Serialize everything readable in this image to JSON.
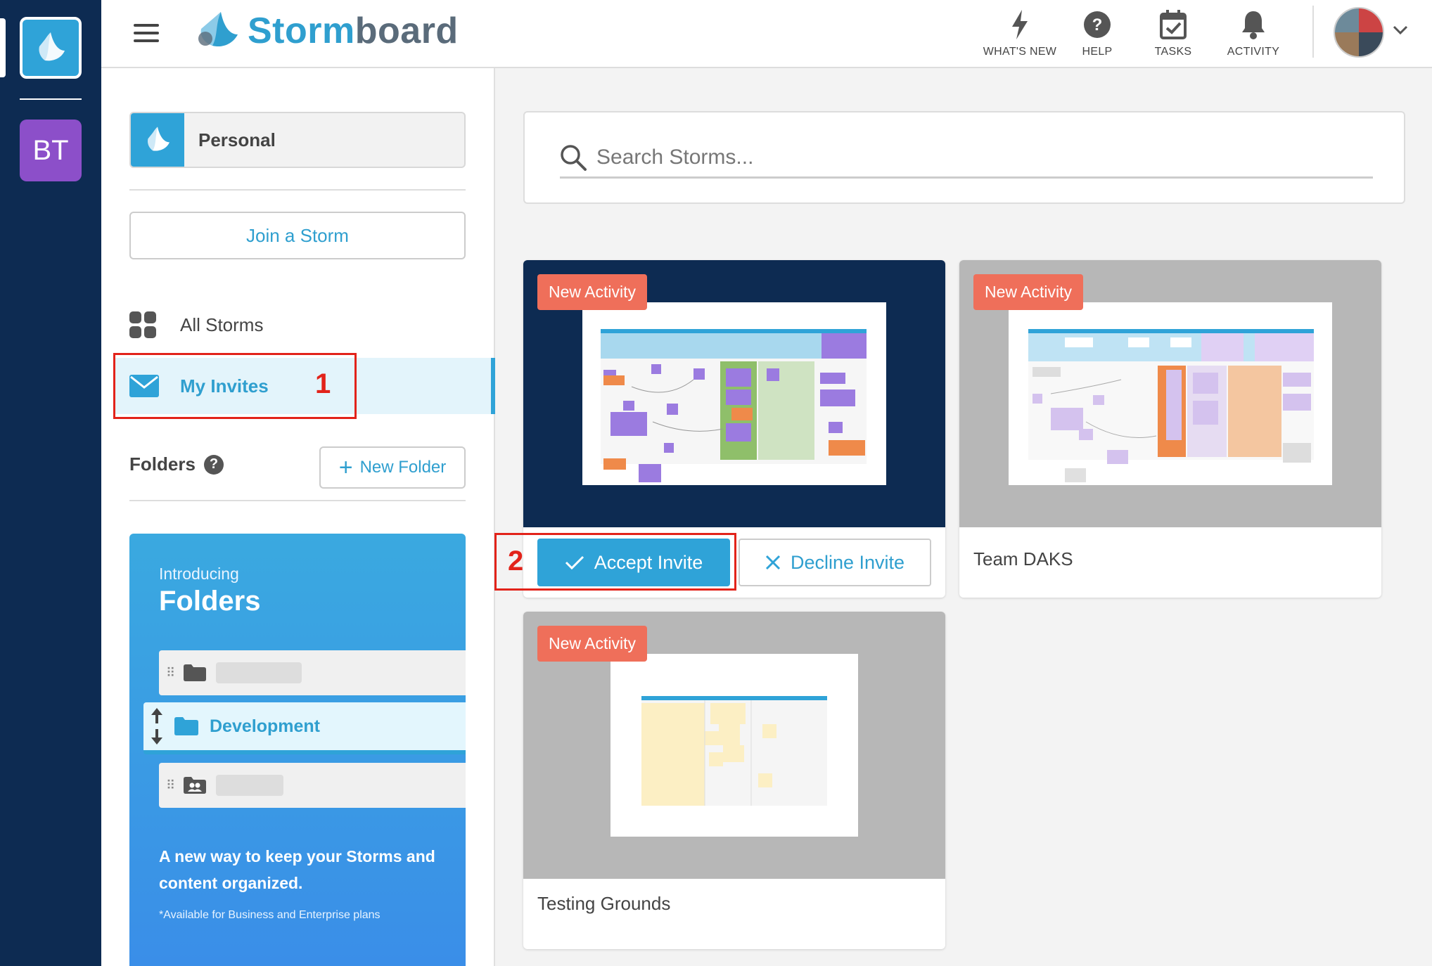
{
  "colors": {
    "rail_bg": "#0d2b52",
    "accent_blue": "#2fa3d8",
    "badge_coral": "#ef6f5a",
    "workspace_purple": "#8c4fc9",
    "annotation_red": "#e2231a"
  },
  "rail": {
    "logo_icon": "stormboard-logo-icon",
    "workspace_initials": "BT"
  },
  "header": {
    "brand_part1": "Storm",
    "brand_part2": "board",
    "nav": [
      {
        "label": "WHAT'S NEW",
        "icon": "lightning-icon"
      },
      {
        "label": "HELP",
        "icon": "help-circle-icon"
      },
      {
        "label": "TASKS",
        "icon": "calendar-check-icon"
      },
      {
        "label": "ACTIVITY",
        "icon": "bell-icon"
      }
    ]
  },
  "sidebar": {
    "workspace_label": "Personal",
    "join_storm": "Join a Storm",
    "all_storms": "All Storms",
    "my_invites": "My Invites",
    "folders_title": "Folders",
    "folders_help": "?",
    "new_folder": "New Folder",
    "promo": {
      "intro": "Introducing",
      "title": "Folders",
      "example_folder": "Development",
      "description": "A new way to keep your Storms and content organized.",
      "note": "*Available for Business and Enterprise plans"
    }
  },
  "annotations": {
    "step1": "1",
    "step2": "2"
  },
  "search": {
    "placeholder": "Search Storms..."
  },
  "cards": [
    {
      "badge": "New Activity",
      "title": "",
      "accept": "Accept Invite",
      "decline": "Decline Invite"
    },
    {
      "badge": "New Activity",
      "title": "Team DAKS"
    },
    {
      "badge": "New Activity",
      "title": "Testing Grounds"
    }
  ]
}
